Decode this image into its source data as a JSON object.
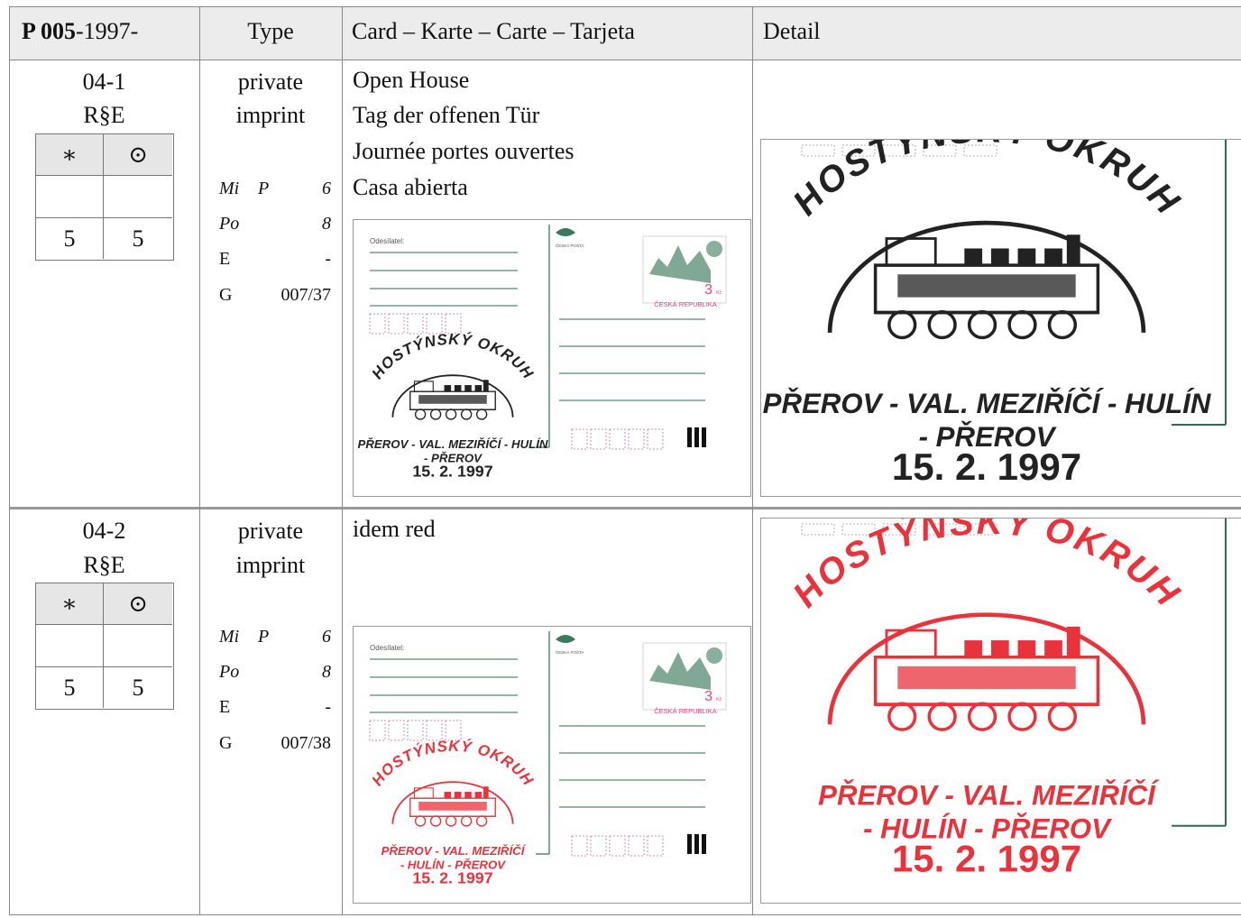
{
  "header": {
    "id_bold": "P 005",
    "id_rest": "-1997-",
    "type": "Type",
    "card": "Card – Karte – Carte – Tarjeta",
    "detail": "Detail"
  },
  "rows": [
    {
      "number": "04-1",
      "code": "R§E",
      "mint_symbol": "∗",
      "used_symbol": "⊙",
      "mint_value": "5",
      "used_value": "5",
      "type_line1": "private",
      "type_line2": "imprint",
      "catalog": [
        {
          "label": "Mi",
          "sub": "P",
          "value": "6"
        },
        {
          "label": "Po",
          "sub": "",
          "value": "8"
        },
        {
          "label": "E",
          "sub": "",
          "value": "-"
        },
        {
          "label": "G",
          "sub": "",
          "value": "007/37"
        }
      ],
      "desc": [
        "Open House",
        "Tag der offenen Tür",
        "Journée portes ouvertes",
        "Casa abierta"
      ],
      "stamp_color": "#222222",
      "stamp_lines": [
        "PŘEROV - VAL. MEZIŘÍČÍ - HULÍN",
        "- PŘEROV",
        "15. 2. 1997"
      ]
    },
    {
      "number": "04-2",
      "code": "R§E",
      "mint_symbol": "∗",
      "used_symbol": "⊙",
      "mint_value": "5",
      "used_value": "5",
      "type_line1": "private",
      "type_line2": "imprint",
      "catalog": [
        {
          "label": "Mi",
          "sub": "P",
          "value": "6"
        },
        {
          "label": "Po",
          "sub": "",
          "value": "8"
        },
        {
          "label": "E",
          "sub": "",
          "value": "-"
        },
        {
          "label": "G",
          "sub": "",
          "value": "007/38"
        }
      ],
      "desc": [
        "idem red"
      ],
      "stamp_color": "#e8323c",
      "stamp_lines": [
        "PŘEROV - VAL. MEZIŘÍČÍ",
        "- HULÍN - PŘEROV",
        "15. 2. 1997"
      ]
    }
  ],
  "card_texts": {
    "sender": "Odesílatel:",
    "post": "ČESKÁ POŠTA",
    "country": "ČESKÁ REPUBLIKA",
    "value": "3",
    "unit": "Kč",
    "arc_title": "HOSTÝNSKÝ OKRUH"
  },
  "colors": {
    "line_green": "#2e6b4f",
    "stamp_green": "#3c7a5c",
    "value_pink": "#e0457a"
  }
}
